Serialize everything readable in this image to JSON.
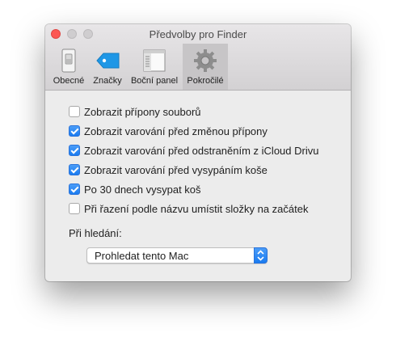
{
  "window": {
    "title": "Předvolby pro Finder"
  },
  "tabs": [
    {
      "label": "Obecné",
      "icon": "switch-icon",
      "active": false
    },
    {
      "label": "Značky",
      "icon": "tag-icon",
      "active": false
    },
    {
      "label": "Boční panel",
      "icon": "sidebar-icon",
      "active": false
    },
    {
      "label": "Pokročilé",
      "icon": "gear-icon",
      "active": true
    }
  ],
  "options": [
    {
      "label": "Zobrazit přípony souborů",
      "checked": false
    },
    {
      "label": "Zobrazit varování před změnou přípony",
      "checked": true
    },
    {
      "label": "Zobrazit varování před odstraněním z iCloud Drivu",
      "checked": true
    },
    {
      "label": "Zobrazit varování před vysypáním koše",
      "checked": true
    },
    {
      "label": "Po 30 dnech vysypat koš",
      "checked": true
    },
    {
      "label": "Při řazení podle názvu umístit složky na začátek",
      "checked": false
    }
  ],
  "search": {
    "label": "Při hledání:",
    "selected": "Prohledat tento Mac"
  },
  "colors": {
    "accent": "#1a7bf0",
    "close": "#fc5753"
  }
}
